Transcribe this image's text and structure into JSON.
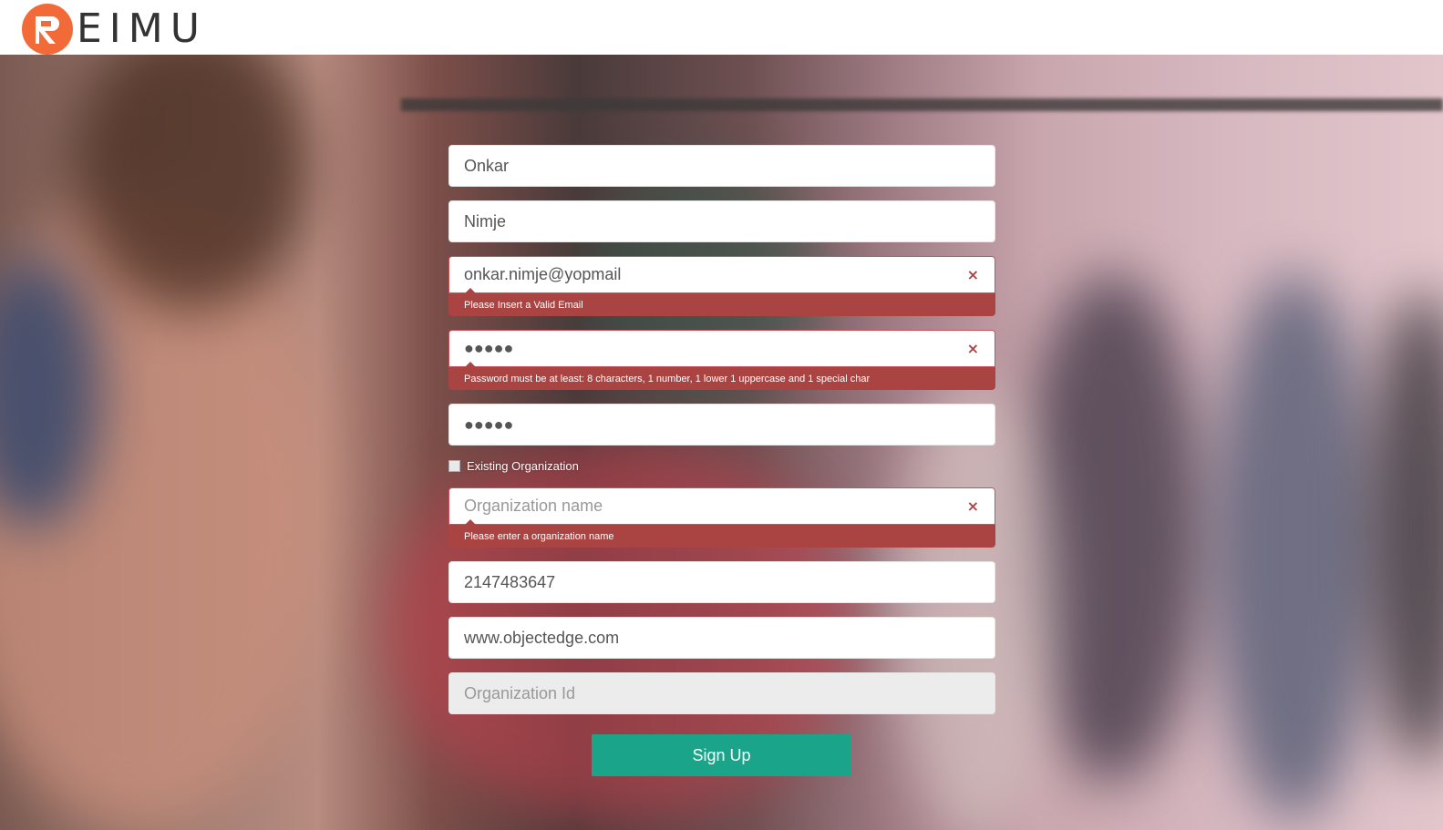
{
  "header": {
    "logo_text": "EIMU",
    "logo_letter": "R"
  },
  "form": {
    "first_name": "Onkar",
    "last_name": "Nimje",
    "email": {
      "value": "onkar.nimje@yopmail",
      "error": "Please Insert a Valid Email"
    },
    "password": {
      "value": "●●●●●",
      "error": "Password must be at least: 8 characters, 1 number, 1 lower 1 uppercase and 1 special char"
    },
    "confirm_password": "●●●●●",
    "existing_org_label": "Existing Organization",
    "org_name": {
      "placeholder": "Organization name",
      "error": "Please enter a organization name"
    },
    "phone": "2147483647",
    "website": "www.objectedge.com",
    "org_id_placeholder": "Organization Id",
    "error_icon": "×",
    "signup_label": "Sign Up"
  },
  "colors": {
    "brand": "#f26a38",
    "error": "#a94442",
    "primary_button": "#1aa58a"
  }
}
